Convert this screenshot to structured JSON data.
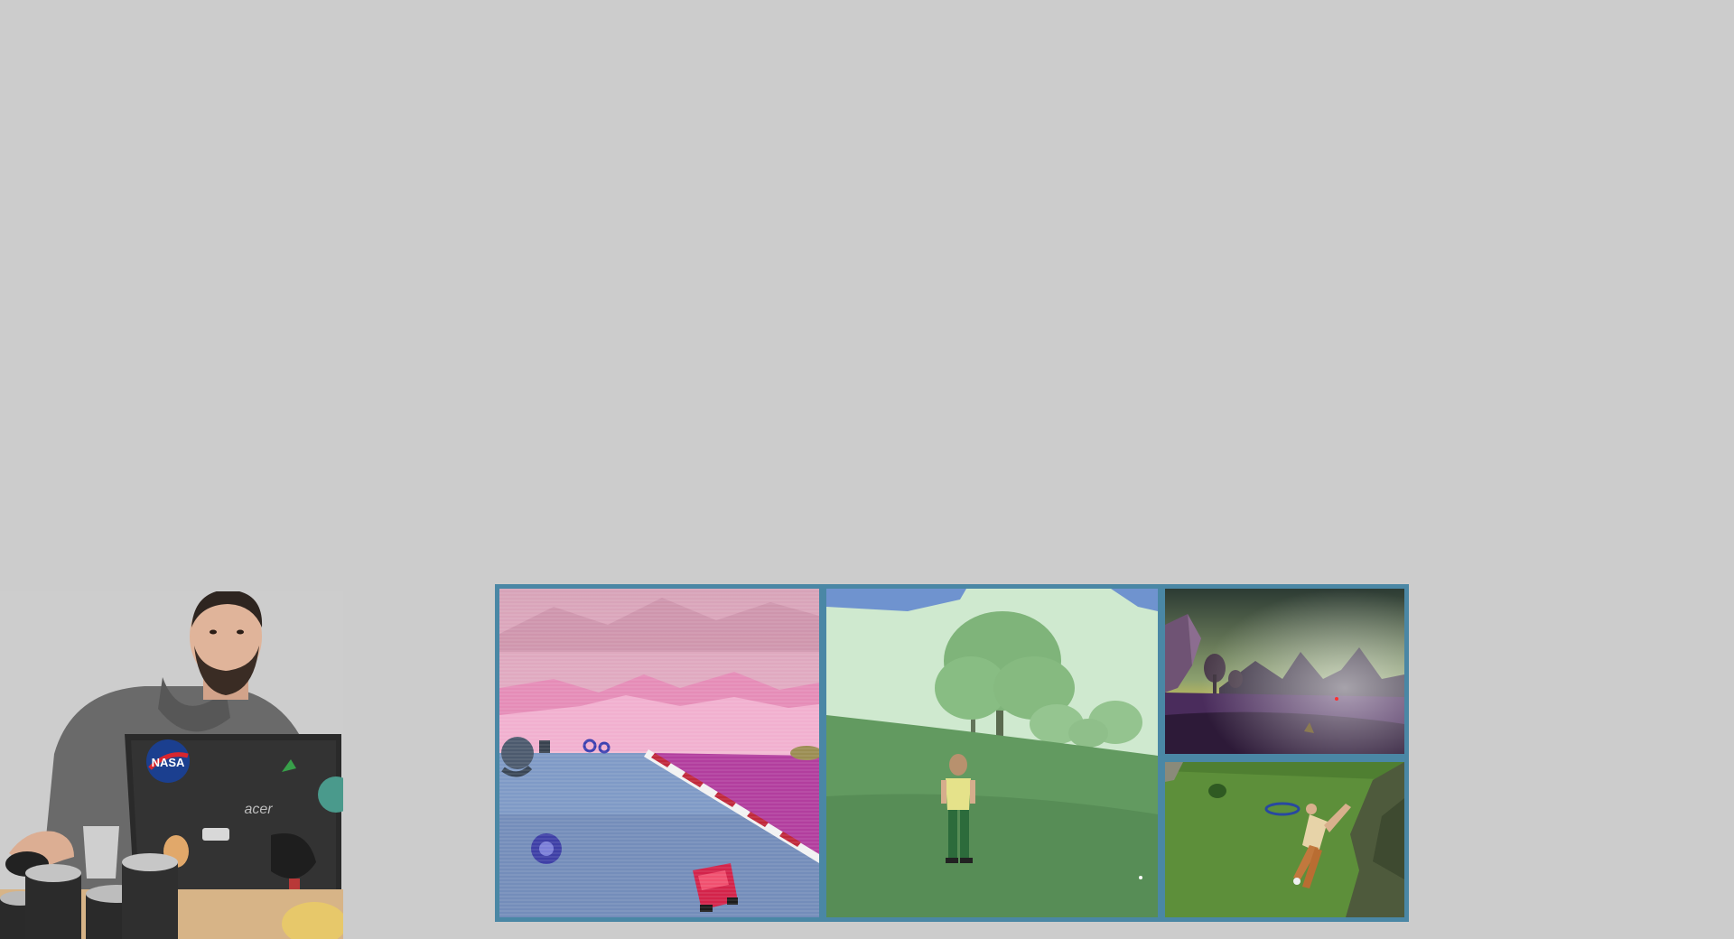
{
  "photo": {
    "laptop_brand": "acer",
    "sticker_text": "NASA"
  },
  "colors": {
    "background": "#cccccc",
    "collage_frame": "#4a87a5",
    "racing_sky": "#e6a8c8",
    "meadow_sky": "#cfe9cf",
    "dusk_sky": "#2f3b34",
    "hillside_grass": "#5d8f3a"
  }
}
